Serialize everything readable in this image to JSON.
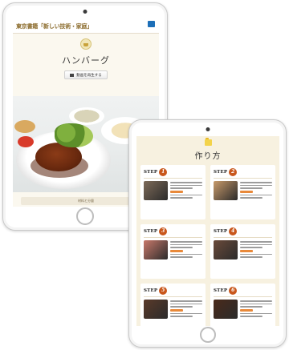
{
  "back_tablet": {
    "publisher_title": "東京書籍「新しい技術・家庭」",
    "publisher_logo_icon": "tokyo-shoseki-logo-icon",
    "recipe_icon": "cooking-pot-icon",
    "dish_name": "ハンバーグ",
    "video_button": {
      "icon": "film-icon",
      "label": "動画を再生する"
    },
    "ingredients_label": "材料と分量"
  },
  "front_tablet": {
    "section_icon": "folder-icon",
    "section_title": "作り方",
    "steps": [
      {
        "word": "STEP",
        "number": "1",
        "thumb_color": "#7d6a58"
      },
      {
        "word": "STEP",
        "number": "2",
        "thumb_color": "#c89a6a"
      },
      {
        "word": "STEP",
        "number": "3",
        "thumb_color": "#c8786a"
      },
      {
        "word": "STEP",
        "number": "4",
        "thumb_color": "#6a4a3a"
      },
      {
        "word": "STEP",
        "number": "5",
        "thumb_color": "#5a3a2a"
      },
      {
        "word": "STEP",
        "number": "6",
        "thumb_color": "#4a2a1a"
      }
    ],
    "accent_color": "#c9571c",
    "background_color": "#f7f1e0"
  }
}
